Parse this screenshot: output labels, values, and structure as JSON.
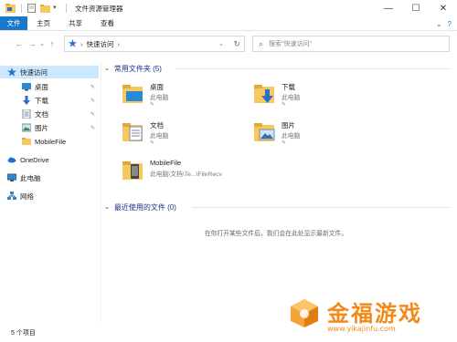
{
  "window": {
    "title": "文件资源管理器",
    "controls": {
      "minimize": "—",
      "maximize": "☐",
      "close": "✕"
    }
  },
  "ribbon": {
    "tabs": [
      "文件",
      "主页",
      "共享",
      "查看"
    ],
    "expand_glyph": "⌄",
    "help_glyph": "?"
  },
  "address": {
    "back_glyph": "←",
    "forward_glyph": "→",
    "recent_glyph": "⌄",
    "up_glyph": "↑",
    "path_sep": "›",
    "location": "快速访问",
    "trail_sep": "›",
    "dropdown_glyph": "⌄",
    "refresh_glyph": "↻"
  },
  "search": {
    "placeholder": "搜索\"快速访问\"",
    "icon": "search-icon",
    "glyph": "⌕"
  },
  "sidebar": {
    "items": [
      {
        "label": "快速访问",
        "icon": "star-icon",
        "pinned": false,
        "selected": true
      },
      {
        "label": "桌面",
        "icon": "desktop-icon",
        "pinned": true
      },
      {
        "label": "下载",
        "icon": "download-icon",
        "pinned": true
      },
      {
        "label": "文档",
        "icon": "document-icon",
        "pinned": true
      },
      {
        "label": "图片",
        "icon": "picture-icon",
        "pinned": true
      },
      {
        "label": "MobileFile",
        "icon": "folder-icon",
        "pinned": false
      },
      {
        "label": "OneDrive",
        "icon": "cloud-icon",
        "pinned": false
      },
      {
        "label": "此电脑",
        "icon": "computer-icon",
        "pinned": false
      },
      {
        "label": "网络",
        "icon": "network-icon",
        "pinned": false
      }
    ],
    "pin_glyph": "📌"
  },
  "main": {
    "frequent": {
      "header": "常用文件夹 (5)",
      "chevron": "⌄",
      "folders": [
        {
          "name": "桌面",
          "sub": "此电脑",
          "pinned": true
        },
        {
          "name": "下载",
          "sub": "此电脑",
          "pinned": true
        },
        {
          "name": "文档",
          "sub": "此电脑",
          "pinned": true
        },
        {
          "name": "图片",
          "sub": "此电脑",
          "pinned": true
        },
        {
          "name": "MobileFile",
          "sub": "此电脑\\文档\\Te...\\FileRecv",
          "pinned": false
        }
      ]
    },
    "recent": {
      "header": "最近使用的文件 (0)",
      "chevron": "⌄",
      "empty_message": "在你打开某些文件后，我们会在此处显示最新文件。"
    }
  },
  "status": {
    "count": "5 个项目"
  },
  "watermark": {
    "text": "金福游戏",
    "url": "www.yikajinfu.com"
  },
  "colors": {
    "accent": "#1979ca",
    "selected": "#cce8ff",
    "folder": "#f6c85f",
    "watermark": "#f28a1a"
  }
}
